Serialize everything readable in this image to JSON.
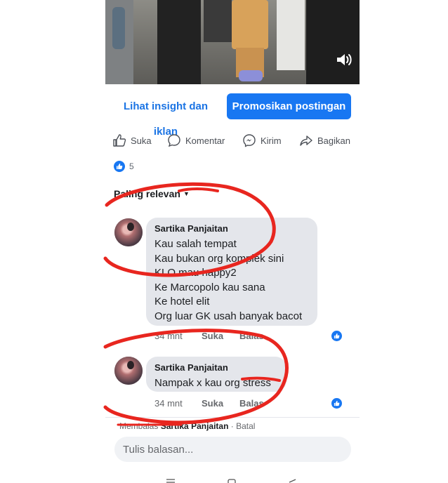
{
  "post_actions": {
    "insight_label": "Lihat insight dan iklan",
    "promote_label": "Promosikan postingan"
  },
  "reactions": {
    "like": {
      "label": "Suka",
      "icon": "thumbs-up-icon"
    },
    "comment": {
      "label": "Komentar",
      "icon": "speech-bubble-icon"
    },
    "send": {
      "label": "Kirim",
      "icon": "messenger-icon"
    },
    "share": {
      "label": "Bagikan",
      "icon": "share-arrow-icon"
    }
  },
  "like_count": "5",
  "sort_label": "Paling relevan",
  "comments": [
    {
      "author": "Sartika Panjaitan",
      "lines": [
        "Kau salah tempat",
        "Kau bukan org komplek sini",
        "KLO mau happy2",
        "Ke Marcopolo kau sana",
        "Ke hotel elit",
        "Org luar GK usah banyak bacot"
      ],
      "time": "34 mnt",
      "like_label": "Suka",
      "reply_label": "Balas",
      "reaction_count": "1"
    },
    {
      "author": "Sartika Panjaitan",
      "lines": [
        "Nampak x kau org stress"
      ],
      "time": "34 mnt",
      "like_label": "Suka",
      "reply_label": "Balas",
      "reaction_count": "1"
    }
  ],
  "reply_bar": {
    "prefix": "Membalas",
    "name": "Sartika Panjaitan",
    "cancel": "· Batal",
    "placeholder": "Tulis balasan..."
  },
  "colors": {
    "accent": "#1877f2",
    "bubble": "#e4e6eb",
    "annotation": "#e8261f"
  }
}
